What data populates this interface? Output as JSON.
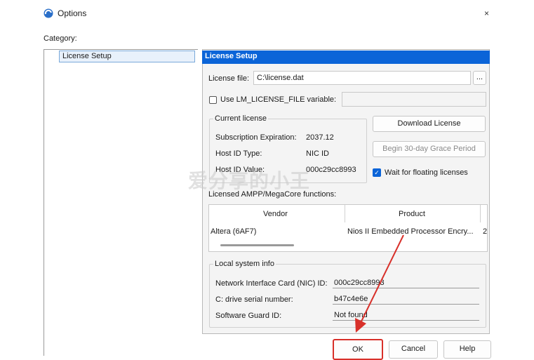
{
  "window": {
    "title": "Options",
    "close_glyph": "×"
  },
  "category": {
    "label": "Category:",
    "items": [
      {
        "label": "License Setup"
      }
    ]
  },
  "panel": {
    "header": "License Setup",
    "license_file": {
      "label": "License file:",
      "value": "C:\\license.dat",
      "browse_label": "..."
    },
    "use_env": {
      "label": "Use LM_LICENSE_FILE variable:",
      "checked": false,
      "value": ""
    },
    "current_license": {
      "title": "Current license",
      "rows": [
        {
          "label": "Subscription Expiration:",
          "value": "2037.12"
        },
        {
          "label": "Host ID Type:",
          "value": "NIC ID"
        },
        {
          "label": "Host ID Value:",
          "value": "000c29cc8993"
        }
      ]
    },
    "download_button": "Download License",
    "grace_button": "Begin 30-day Grace Period",
    "wait_floating": {
      "label": "Wait for floating licenses",
      "checked": true
    },
    "functions_label": "Licensed AMPP/MegaCore functions:",
    "table": {
      "columns": [
        "Vendor",
        "Product"
      ],
      "rows": [
        {
          "vendor": "Altera (6AF7)",
          "product": "Nios II Embedded Processor Encry...",
          "extra": "2"
        }
      ]
    },
    "local_info": {
      "title": "Local system info",
      "rows": [
        {
          "label": "Network Interface Card (NIC) ID:",
          "value": "000c29cc8993"
        },
        {
          "label": "C: drive serial number:",
          "value": "b47c4e6e"
        },
        {
          "label": "Software Guard ID:",
          "value": "Not found"
        }
      ]
    }
  },
  "footer": {
    "ok": "OK",
    "cancel": "Cancel",
    "help": "Help"
  },
  "watermark": "爱分享的小王",
  "colors": {
    "accent": "#0b64d8",
    "annotation_red": "#d8302a"
  }
}
